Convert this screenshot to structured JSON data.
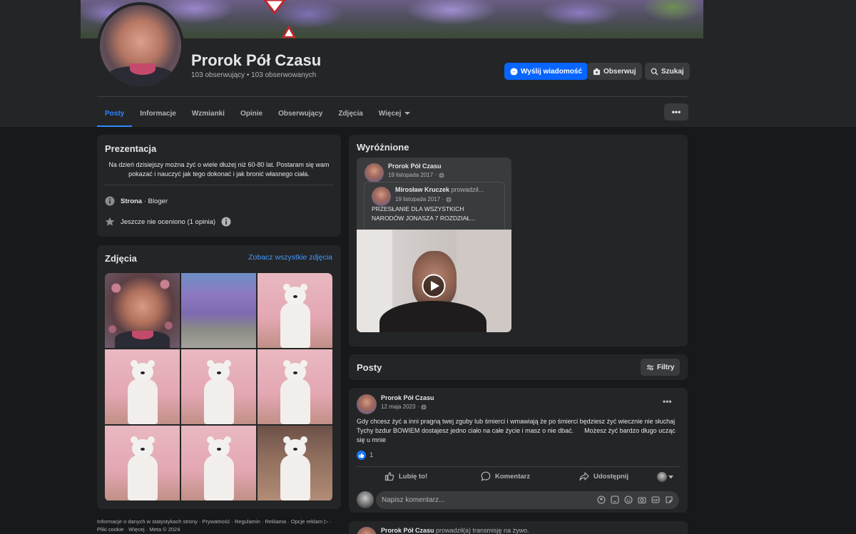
{
  "profile": {
    "name": "Prorok Pół Czasu",
    "stats": "103 obserwujący • 103 obserwowanych"
  },
  "actions": {
    "message": "Wyślij wiadomość",
    "follow": "Obserwuj",
    "search": "Szukaj"
  },
  "tabs": [
    {
      "label": "Posty",
      "active": true
    },
    {
      "label": "Informacje"
    },
    {
      "label": "Wzmianki"
    },
    {
      "label": "Opinie"
    },
    {
      "label": "Obserwujący"
    },
    {
      "label": "Zdjęcia"
    },
    {
      "label": "Więcej"
    }
  ],
  "more_button": "•••",
  "intro": {
    "title": "Prezentacja",
    "bio": "Na dzień dzisiejszy można żyć o wiele dłużej niż 60-80 lat. Postaram się wam pokazać i nauczyć jak tego dokonać i jak bronić własnego ciała.",
    "category_bold": "Strona",
    "category_rest": " · Bloger",
    "rating": "Jeszcze nie oceniono (1 opinia)"
  },
  "photos": {
    "title": "Zdjęcia",
    "see_all": "Zobacz wszystkie zdjęcia"
  },
  "footer": "Informacje o danych w statystykach strony · Prywatność · Regulamin · Reklama · Opcje reklam ▷ · Pliki cookie · Więcej · Meta © 2024",
  "featured": {
    "title": "Wyróżnione",
    "author": "Prorok Pół Czasu",
    "date": "19 listopada 2017 ·",
    "shared_author": "Mirosław Kruczek",
    "shared_action": " prowadził...",
    "shared_date": "19 listopada 2017 ·",
    "shared_text": "PRZESŁANIE DLA WSZYSTKICH NARODÓW JONASZA 7 ROZDZIAŁ..."
  },
  "posts_header": {
    "title": "Posty",
    "filters": "Filtry"
  },
  "post": {
    "author": "Prorok Pół Czasu",
    "date": "12 maja 2023 ·",
    "text": "Gdy chcesz żyć a inni pragną twej zguby lub śmierci i wmawiają że po śmierci będziesz żyć wiecznie nie słuchaj Tychy bzdur BOWIEM dostajesz jedno ciało na całe życie i masz o nie dbać.      Możesz żyć bardzo długo ucząc się u mnie",
    "likes": "1",
    "like_label": "Lubię to!",
    "comment_label": "Komentarz",
    "share_label": "Udostępnij",
    "comment_placeholder": "Napisz komentarz..."
  },
  "next_post": {
    "author": "Prorok Pół Czasu",
    "action": " prowadził(a) transmisję na żywo."
  },
  "colors": {
    "accent": "#0866ff",
    "link": "#4599ff",
    "bg": "#18191a",
    "card": "#242526"
  }
}
